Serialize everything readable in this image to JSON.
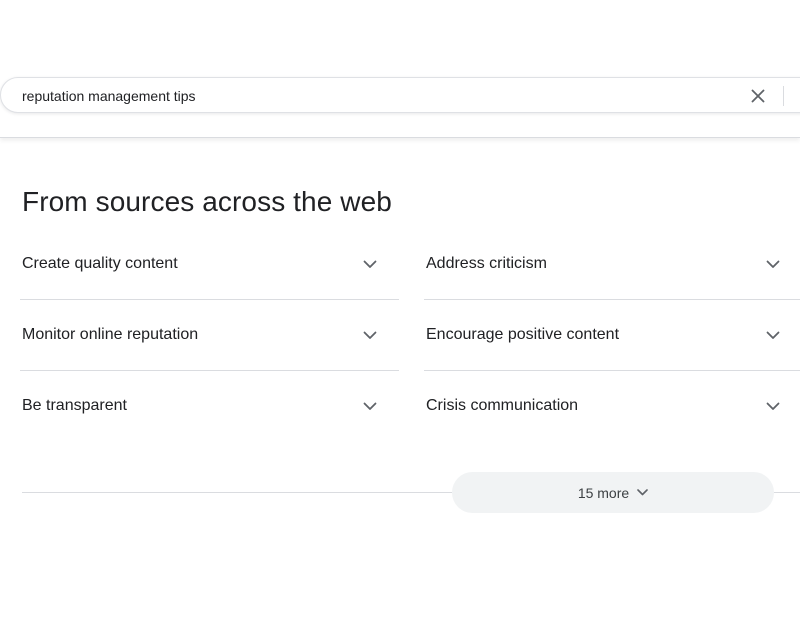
{
  "search": {
    "query": "reputation management tips"
  },
  "icons": {
    "clear": "close-icon",
    "expand": "chevron-down-icon"
  },
  "section": {
    "title": "From sources across the web",
    "items": [
      {
        "label": "Create quality content"
      },
      {
        "label": "Address criticism"
      },
      {
        "label": "Monitor online reputation"
      },
      {
        "label": "Encourage positive content"
      },
      {
        "label": "Be transparent"
      },
      {
        "label": "Crisis communication"
      }
    ],
    "more_label": "15 more"
  },
  "colors": {
    "text": "#202124",
    "divider": "#dadce0",
    "pill": "#f1f3f4",
    "icon": "#5f6368"
  }
}
